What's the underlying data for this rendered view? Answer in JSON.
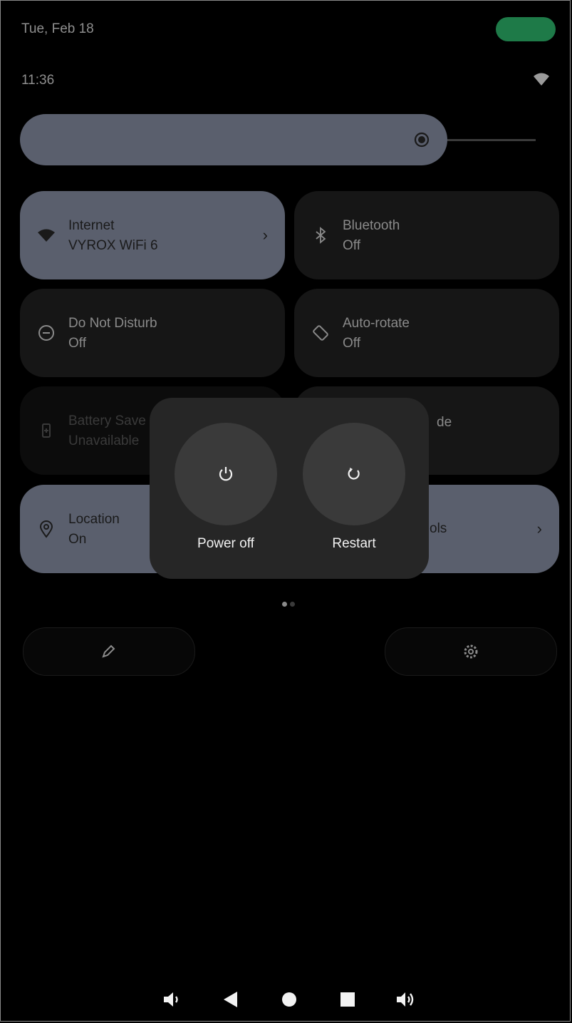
{
  "status_bar": {
    "date": "Tue, Feb 18",
    "time": "11:36"
  },
  "brightness": {
    "level": 0.78,
    "icon": "brightness-icon"
  },
  "tiles": {
    "internet": {
      "title": "Internet",
      "subtitle": "VYROX WiFi 6",
      "chevron": "›"
    },
    "bluetooth": {
      "title": "Bluetooth",
      "subtitle": "Off"
    },
    "dnd": {
      "title": "Do Not Disturb",
      "subtitle": "Off"
    },
    "autorotate": {
      "title": "Auto-rotate",
      "subtitle": "Off"
    },
    "battery_saver": {
      "title": "Battery Save",
      "subtitle": "Unavailable"
    },
    "right_row3": {
      "title": "de"
    },
    "location": {
      "title": "Location",
      "subtitle": "On"
    },
    "right_row4": {
      "title": "ols",
      "chevron": "›"
    }
  },
  "page_indicator": {
    "pages": 2,
    "current": 1
  },
  "power_menu": {
    "power_off_label": "Power off",
    "restart_label": "Restart"
  },
  "colors": {
    "tile_on": "#5a5f6d",
    "tile_off": "#161616",
    "dialog_bg": "#262626",
    "battery": "#1e7a48"
  }
}
